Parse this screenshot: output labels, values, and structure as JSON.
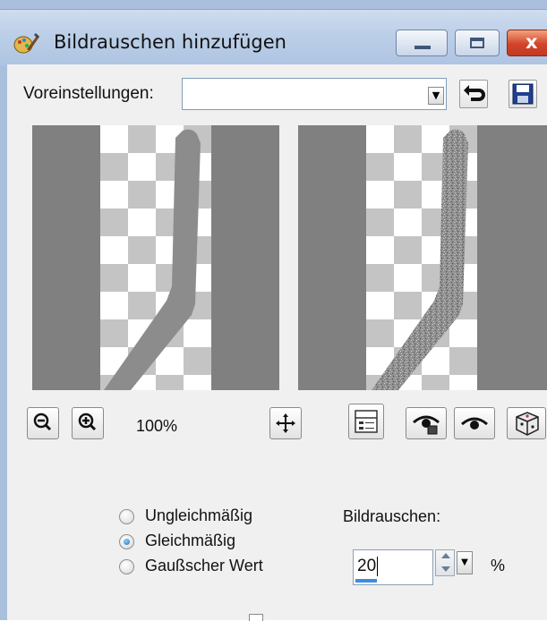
{
  "window": {
    "title": "Bildrauschen hinzufügen",
    "close_glyph": "x"
  },
  "presets": {
    "label": "Voreinstellungen:",
    "value": ""
  },
  "zoom": {
    "level": "100%"
  },
  "noise_type": {
    "options": [
      "Ungleichmäßig",
      "Gleichmäßig",
      "Gaußscher Wert"
    ],
    "selected": "Gleichmäßig"
  },
  "noise_amount": {
    "label": "Bildrauschen:",
    "value": "20",
    "unit": "%"
  },
  "icons": {
    "app": "paint-brush-icon",
    "zoom_out": "zoom-out-icon",
    "zoom_in": "zoom-in-icon",
    "pan": "move-icon",
    "proof": "proof-icon",
    "reset": "reset-icon",
    "save": "save-icon"
  },
  "colors": {
    "titlebar": "#bccfe8",
    "close_button": "#d2442a",
    "preview_bg": "#808080",
    "spin_progress": "#3a8ee6"
  }
}
